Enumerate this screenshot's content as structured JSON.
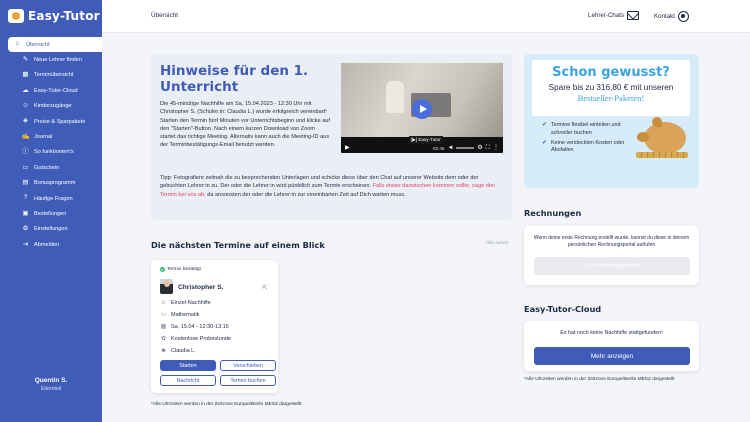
{
  "app": {
    "name": "Easy-Tutor"
  },
  "sidebar": {
    "items": [
      {
        "label": "Übersicht",
        "icon": "home-icon",
        "glyph": "⌂"
      },
      {
        "label": "Neue Lehrer finden",
        "icon": "search-user-icon",
        "glyph": "✎"
      },
      {
        "label": "Terminübersicht",
        "icon": "calendar-icon",
        "glyph": "▦"
      },
      {
        "label": "Easy-Tutor-Cloud",
        "icon": "cloud-icon",
        "glyph": "☁"
      },
      {
        "label": "Kinderzugänge",
        "icon": "children-icon",
        "glyph": "☺"
      },
      {
        "label": "Preise & Sparpakete",
        "icon": "tag-icon",
        "glyph": "◈"
      },
      {
        "label": "Journal",
        "icon": "journal-icon",
        "glyph": "✍"
      },
      {
        "label": "So funktioniert's",
        "icon": "info-icon",
        "glyph": "ⓘ"
      },
      {
        "label": "Gutschein",
        "icon": "voucher-icon",
        "glyph": "▭"
      },
      {
        "label": "Bonusprogramm",
        "icon": "bonus-icon",
        "glyph": "▤"
      },
      {
        "label": "Häufige Fragen",
        "icon": "help-icon",
        "glyph": "?"
      },
      {
        "label": "Bestellungen",
        "icon": "orders-icon",
        "glyph": "▣"
      },
      {
        "label": "Einstellungen",
        "icon": "gear-icon",
        "glyph": "⚙"
      },
      {
        "label": "Abmelden",
        "icon": "logout-icon",
        "glyph": "⇥"
      }
    ],
    "user": {
      "name": "Quentin S.",
      "role": "Elternteil"
    }
  },
  "topbar": {
    "breadcrumb": "Übersicht",
    "chats": "Lehrer-Chats",
    "contact": "Kontakt"
  },
  "info": {
    "title": "Hinweise für den 1. Unterricht",
    "text": "Die 45-minütige Nachhilfe am Sa, 15.04.2023 - 12:30 Uhr mit Christopher S. (Schüler:in: Claudia L.) wurde erfolgreich vereinbart! Starten den Termin fünf Minuten vor Unterrichtsbeginn und klicke auf den \"Starten\"-Button. Nach einem kurzen Download von Zoom startet das richtige Meeting. Alternativ kann auch die Meeting-ID aus der Terminbestätigungs-Email benutzt werden.",
    "tip_a": "Tipp: Fotografiere zeitnah die zu besprechenden Unterlagen und schicke diese über den Chat auf unserer Website dem oder der gebuchten Lehrer:in zu. Der oder die Lehrer:in wird pünktlich zum Termin erscheinen. ",
    "tip_red": "Falls etwas dazwischen kommen sollte, sage den Termin bei uns ab,",
    "tip_b": " da ansonsten der oder die Lehrer:in zur vereinbarten Zeit auf Dich warten muss.",
    "video_label": "[▶] Easy-Tutor",
    "video_time": "-02:46"
  },
  "promo": {
    "title": "Schon gewusst?",
    "line1": "Spare bis zu 316,80 € mit unseren",
    "line2": "Bestseller-Paketen!",
    "items": [
      "Termine flexibel einteilen und schneller buchen",
      "Keine versteckten Kosten oder Abofallen"
    ]
  },
  "rechnungen": {
    "title": "Rechnungen",
    "text": "Wenn deine erste Rechnung erstellt wurde, kannst du diese in deinem persönlichen Rechnungsportal aufrufen",
    "button": "Zum Rechnungsportal"
  },
  "cloud": {
    "title": "Easy-Tutor-Cloud",
    "text": "Es hat noch keine Nachhilfe stattgefunden!",
    "button": "Mehr anzeigen",
    "footnote": "*Alle Uhrzeiten werden in der Zeitzone Europe/Berlin MESZ dargestellt"
  },
  "termine": {
    "title": "Die nächsten Termine auf einem Blick",
    "all_link": "Alle sehen",
    "footnote": "*Alle Uhrzeiten werden in der Zeitzone Europe/Berlin MESZ dargestellt",
    "appointment": {
      "status": "Termin bestätigt",
      "tutor": "Christopher S.",
      "type": "Einzel-Nachhilfe",
      "subject": "Mathematik",
      "date": "Sa, 15.04 - 12:30-13:15",
      "trial": "Kostenlose Probestunde",
      "student": "Claudia L.",
      "buttons": {
        "start": "Starten",
        "move": "Verschieben",
        "message": "Nachricht",
        "book": "Termin buchen"
      }
    }
  }
}
